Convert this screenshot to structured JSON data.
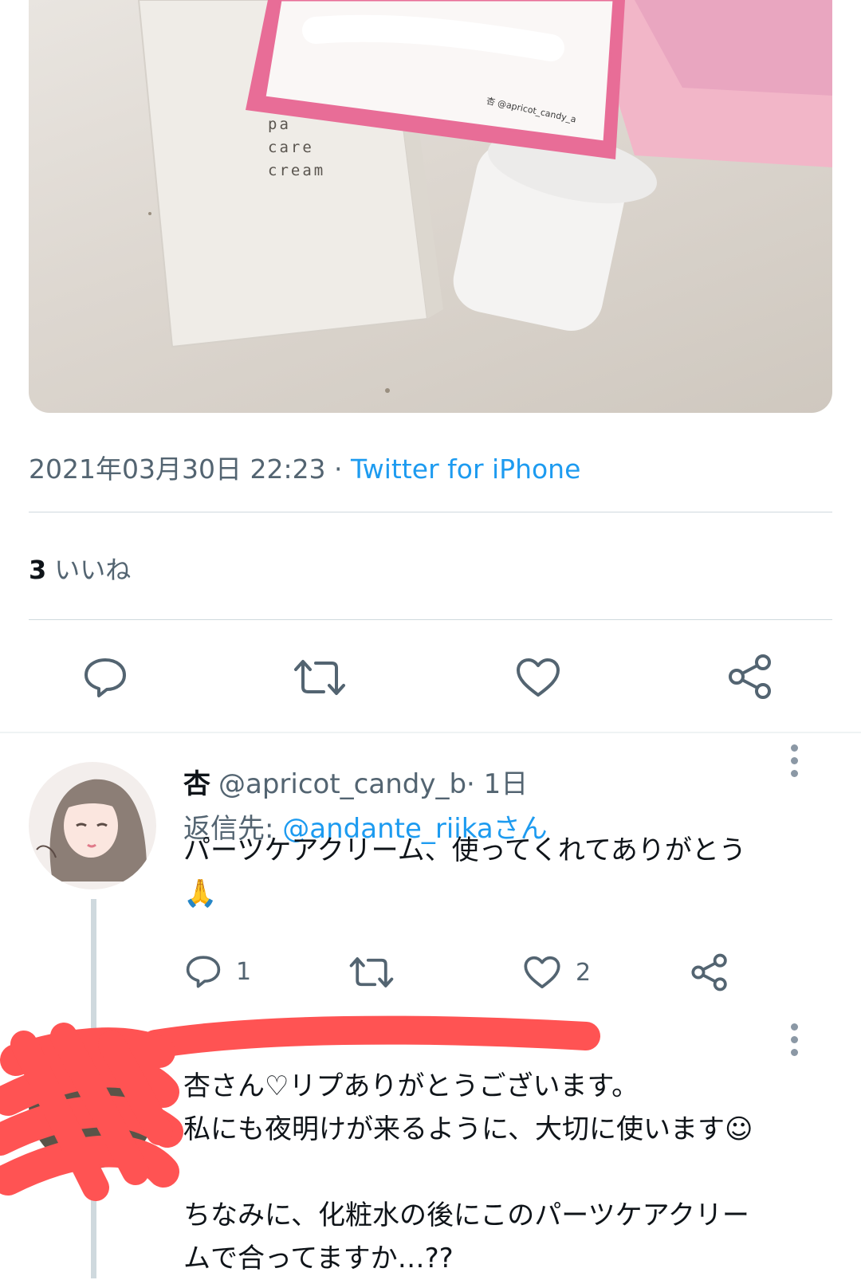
{
  "photo": {
    "lettering": [
      "pa",
      "care",
      "cream"
    ],
    "card_handle": "杏 @apricot_candy_a"
  },
  "tweet": {
    "timestamp": "2021年03月30日 22:23",
    "separator": " · ",
    "client": "Twitter for iPhone",
    "likes_count": "3",
    "likes_label": "いいね"
  },
  "reply1": {
    "name": "杏",
    "handle": "@apricot_candy_b",
    "time": "· 1日",
    "reply_to_label": "返信先: ",
    "reply_to_mention": "@andante_riikaさん",
    "text": "パーツケアクリーム、使ってくれてありがとう\n🙏‪‪‪‪‬‬‬‬‬‪‪‪‪‬‬‬‬‬‪‪‪‪‬‬‬‬‬‪‪‪‪‬‬‬‬‬‪‪‪‪‬‬‬‬‬‪‪‪‪‬‬‬‬‬‪‪‪‪‬‬‬‬‬‪‪‪‪‬‬‬‬‬‪‪‪‪‬‬‬‬‬‪‪‪‪‬‬‬‬‬‪‪‪‪‬‬‬‬‬‪‪‪‪‬‬‬‬‬‪‪‪‪‬‬‬‬‬‪‪‪‪‬‬‬‬‬‪‪‪‪‬‬‬‬‬‪‪‪‪‬‬‬‬‬‪‪‪‪‬‬‬‬‬‪‪‪‪‬‬‬‬‬‪‪‪‪‬‬‬‬‬‪‪‪‪‬‬‬‬‬‪‪‪‪‬‬‬‬‬‪‪‪‪‬‬‬‬‬‪‪‪‪‬‬‬‬‬‪‪‪‪‬‬‬‬‬‪‪‪‪‬‬‬‬‬‪‪‪‪‬‬‬‬‬‪‪‪‪‬‬‬‬‬‪‪‪‪‬‬‬‬‬‪‪‪‪‬‬‬‬‬‪‪‪‪‬‬‬‬‬‪‪‪‪‬‬‬‬‬‪‪‪‪‬‬‬‬‬‪‪‪‪‬‬‬‬‬‪‪‪‪‬‬‬‬‬‪‪‪‪‬‬‬‬‬‪‪‪‪‬‬‬‬‬‪‪‪‪‬‬‬‬‬‪‪‪‪‬‬‬‬‬‪‪‪‪‬‬‬‬‬‪‪‪‪‬‬‬‬‬‪‪‪‪‬‬‬‬‬‪‪‪‪‬‬‬‬‬‪‪‪‪‬‬‬‬‬‪‪‪‪‬‬‬‬‬‪‪‪‪‬‬‬‬‬‪‪‪‪‬‬‬‬‬‪‪‪‪‬‬‬‬‬‪‪‪‪‬‬‬‬‬‪‪‪‪‬‬‬‬‬‪‪‪‪‬‬‬‬‬‪‪‪‪‬‬‬‬‬",
    "reply_count": "1",
    "like_count": "2"
  },
  "reply2": {
    "text": "杏さん♡リプありがとうございます。\n私にも夜明けが来るように、大切に使います☺︎\n\nちなみに、化粧水の後にこのパーツケアクリー\nムで合ってますか…??"
  },
  "colors": {
    "accent": "#1d9bf0",
    "secondary_text": "#536471",
    "redaction": "#ff5353"
  },
  "icons": [
    "reply-icon",
    "retweet-icon",
    "like-icon",
    "share-icon",
    "more-icon"
  ]
}
